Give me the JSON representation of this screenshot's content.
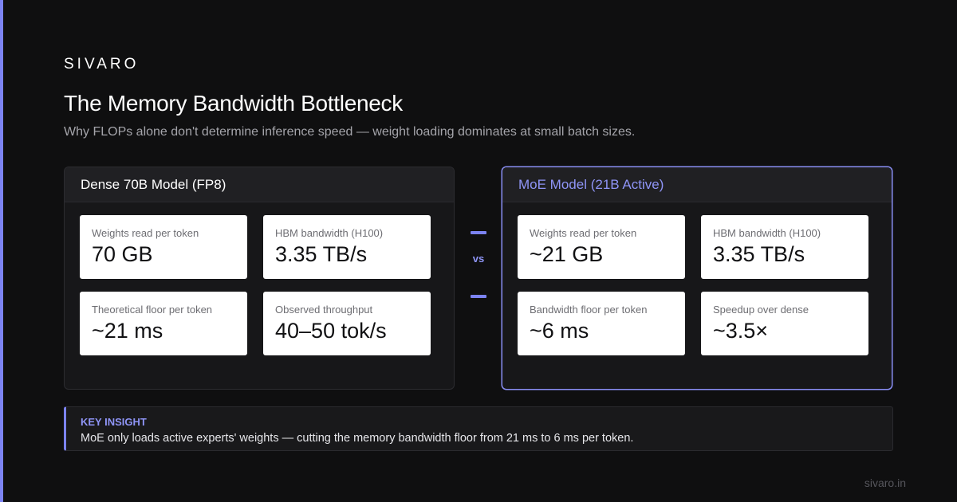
{
  "brand": "SIVARO",
  "title": "The Memory Bandwidth Bottleneck",
  "subtitle": "Why FLOPs alone don't determine inference speed — weight loading dominates at small batch sizes.",
  "comparison_separator": "vs",
  "colors": {
    "accent": "#7c83f2",
    "background": "#0f0f10",
    "card_text": "#111113"
  },
  "cards": [
    {
      "title": "Dense 70B Model (FP8)",
      "stats": [
        {
          "label": "Weights read per token",
          "value": "70 GB"
        },
        {
          "label": "HBM bandwidth (H100)",
          "value": "3.35 TB/s"
        },
        {
          "label": "Theoretical floor per token",
          "value": "~21 ms"
        },
        {
          "label": "Observed throughput",
          "value": "40–50 tok/s"
        }
      ]
    },
    {
      "title": "MoE Model (21B Active)",
      "stats": [
        {
          "label": "Weights read per token",
          "value": "~21 GB"
        },
        {
          "label": "HBM bandwidth (H100)",
          "value": "3.35 TB/s"
        },
        {
          "label": "Bandwidth floor per token",
          "value": "~6 ms"
        },
        {
          "label": "Speedup over dense",
          "value": "~3.5×"
        }
      ]
    }
  ],
  "insight": {
    "title": "KEY INSIGHT",
    "text": "MoE only loads active experts' weights — cutting the memory bandwidth floor from 21 ms to 6 ms per token."
  },
  "footer": "sivaro.in"
}
